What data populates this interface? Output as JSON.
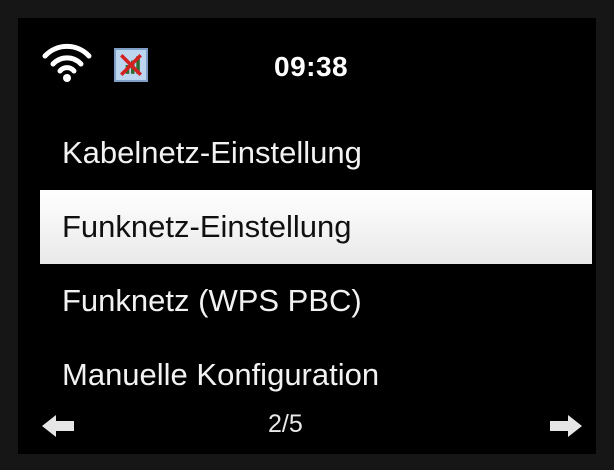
{
  "status": {
    "time": "09:38",
    "wifi_icon": "wifi-icon",
    "signal_icon": "no-signal-icon"
  },
  "menu": {
    "items": [
      {
        "label": "Kabelnetz-Einstellung",
        "selected": false
      },
      {
        "label": "Funknetz-Einstellung",
        "selected": true
      },
      {
        "label": "Funknetz (WPS PBC)",
        "selected": false
      },
      {
        "label": "Manuelle Konfiguration",
        "selected": false
      }
    ]
  },
  "pager": {
    "page": "2/5",
    "prev_icon": "arrow-left-icon",
    "next_icon": "arrow-right-icon"
  },
  "colors": {
    "selection_background": "#ffffff",
    "screen_background": "#000000",
    "text": "#f2f2f2"
  }
}
